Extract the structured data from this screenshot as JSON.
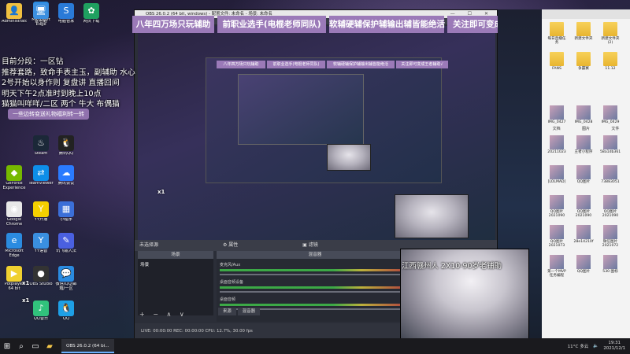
{
  "desktop": {
    "icons": [
      {
        "label": "Administrator",
        "glyph": "👤",
        "color": "#f0c040"
      },
      {
        "label": "Microsoft Edge",
        "glyph": "e",
        "color": "#2b8be0"
      },
      {
        "label": "腾讯QQ",
        "glyph": "🐧",
        "color": "#222"
      },
      {
        "label": "Steam",
        "glyph": "♨",
        "color": "#1b2838"
      },
      {
        "label": "GeForce Experience",
        "glyph": "◆",
        "color": "#76b900"
      },
      {
        "label": "TeamViewer",
        "glyph": "⇄",
        "color": "#0e8ee9"
      },
      {
        "label": "腾讯会议",
        "glyph": "☁",
        "color": "#2a7bff"
      },
      {
        "label": "Google Chrome",
        "glyph": "◉",
        "color": "#e8e8e8"
      },
      {
        "label": "YY开播",
        "glyph": "Y",
        "color": "#f5d000"
      },
      {
        "label": "小程序",
        "glyph": "▦",
        "color": "#3b6fd8"
      },
      {
        "label": "Microsoft Edge",
        "glyph": "e",
        "color": "#2b8be0"
      },
      {
        "label": "YY语音",
        "glyph": "Y",
        "color": "#3a8fe0"
      },
      {
        "label": "讯飞输入法",
        "glyph": "✎",
        "color": "#4a60e0"
      },
      {
        "label": "Potplayer 64 bit",
        "glyph": "▶",
        "color": "#f0d030"
      },
      {
        "label": "OBS Studio",
        "glyph": "●",
        "color": "#333"
      },
      {
        "label": "微信/QQ/邮箱/一区",
        "glyph": "💬",
        "color": "#2a8be0"
      },
      {
        "label": "QQ音乐",
        "glyph": "♪",
        "color": "#31c27c"
      },
      {
        "label": "QQ",
        "glyph": "🐧",
        "color": "#1ea0e6"
      }
    ],
    "top_icons": [
      {
        "label": "此电脑",
        "glyph": "🖥",
        "color": "#3b8fe0"
      },
      {
        "label": "电脑管家",
        "glyph": "S",
        "color": "#2a7ad8"
      },
      {
        "label": "网页下载",
        "glyph": "✿",
        "color": "#1fa060"
      }
    ]
  },
  "overlay": {
    "banners": [
      "八年四万场只玩辅助",
      "前职业选手(电棍老师同队)",
      "软辅硬辅保护辅输出辅皆能绝活",
      "关注即可变成王者辅助√"
    ],
    "notes": [
      "目前分段：一区钻",
      "推荐套路，致命手表主玉，副辅助 水心",
      "2号开始以身作则 复盘讲 直播回间",
      "明天下午2点准时到晚上10点",
      "猫猫叫咩咩/二区 两个 牛大 布偶猫"
    ],
    "promo": "一些边转变送礼物福利转一转",
    "stickers": [
      "x1",
      "x1",
      "x1"
    ],
    "cam_caption": "江西赣州人 2X10-90岁老铺助"
  },
  "obs": {
    "title": "OBS 26.0.2 (64 bit, windows) - 配置文件: 未命名 - 场景: 未命名",
    "window_controls": "— ☐ ✕",
    "status_left": "未选择源",
    "status_props": "⚙ 属性",
    "status_filters": "▣ 滤镜",
    "panel_scenes": "场景",
    "panel_mixer": "混音器",
    "panel_transitions": "转场",
    "scene_item": "场景",
    "mixer_channels": [
      "麦克风/Aux",
      "桌面音频设备",
      "桌面音频"
    ],
    "tabs": [
      "来源",
      "混音器"
    ],
    "controls": "+ − ∧ ∨",
    "bottom_status": "LIVE: 00:00:00   REC: 00:00:00   CPU: 12.7%, 30.00 fps"
  },
  "explorer": {
    "files": [
      {
        "label": "每日直播任务",
        "kind": "folder"
      },
      {
        "label": "新建文件夹",
        "kind": "folder"
      },
      {
        "label": "新建文件夹 (2)",
        "kind": "folder"
      },
      {
        "label": "FANS",
        "kind": "folder"
      },
      {
        "label": "争霸赛",
        "kind": "folder"
      },
      {
        "label": "11.12",
        "kind": "folder"
      },
      {
        "label": "IMG_0427",
        "kind": "photo"
      },
      {
        "label": "IMG_0428",
        "kind": "photo"
      },
      {
        "label": "IMG_0429",
        "kind": "photo"
      },
      {
        "label": "20211023",
        "kind": "photo"
      },
      {
        "label": "王者小程序",
        "kind": "photo"
      },
      {
        "label": "58a1db361",
        "kind": "photo"
      },
      {
        "label": "[LOLMAD]",
        "kind": "photo"
      },
      {
        "label": "QQ图片",
        "kind": "photo"
      },
      {
        "label": "73883051",
        "kind": "photo"
      },
      {
        "label": "QQ图片 2021090",
        "kind": "photo"
      },
      {
        "label": "QQ图片 2021090",
        "kind": "photo"
      },
      {
        "label": "QQ图片 2021090",
        "kind": "photo"
      },
      {
        "label": "QQ图片 2021073",
        "kind": "photo"
      },
      {
        "label": "28e14210f",
        "kind": "photo"
      },
      {
        "label": "微信图片 2021072",
        "kind": "photo"
      },
      {
        "label": "第一个MVP 任务编程",
        "kind": "photo"
      },
      {
        "label": "QQ图片",
        "kind": "photo"
      },
      {
        "label": "530 图标",
        "kind": "photo"
      }
    ],
    "tabs": [
      "文档",
      "图片",
      "文件"
    ]
  },
  "taskbar": {
    "start_glyph": "⊞",
    "search_glyph": "⌕",
    "app_label": "OBS 26.0.2 (64 bi...",
    "weather": "11°C 多云",
    "time": "19:31",
    "date": "2021/12/1"
  }
}
